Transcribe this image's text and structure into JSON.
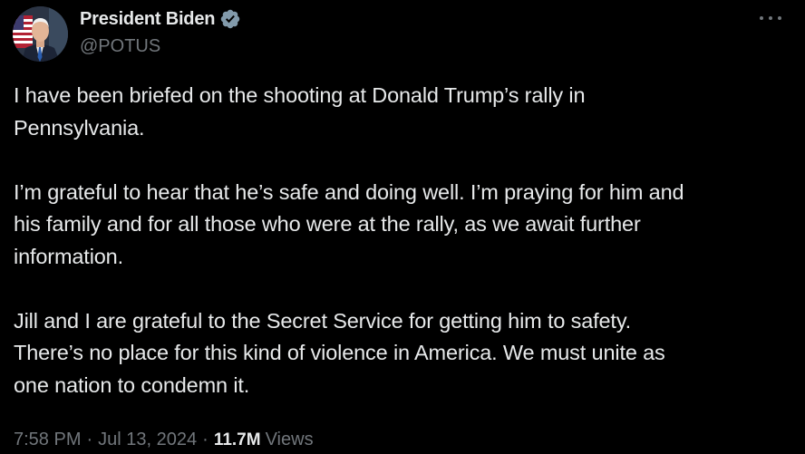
{
  "author": {
    "display_name": "President Biden",
    "handle": "@POTUS",
    "verified_icon": "verified-badge-icon",
    "avatar_icon": "profile-photo"
  },
  "tweet": {
    "paragraphs": [
      "I have been briefed on the shooting at Donald Trump’s rally in\nPennsylvania.",
      "I’m grateful to hear that he’s safe and doing well. I’m praying for him and\nhis family and for all those who were at the rally, as we await further\ninformation.",
      "Jill and I are grateful to the Secret Service for getting him to safety.\nThere’s no place for this kind of violence in America. We must unite as\none nation to condemn it."
    ]
  },
  "meta": {
    "time": "7:58 PM",
    "separator": "·",
    "date": "Jul 13, 2024",
    "views_count": "11.7M",
    "views_label": "Views"
  },
  "more_menu_icon": "more-horizontal-icon",
  "colors": {
    "background": "#000000",
    "primary_text": "#e7e9ea",
    "secondary_text": "#71767b",
    "verified": "#829aab"
  }
}
